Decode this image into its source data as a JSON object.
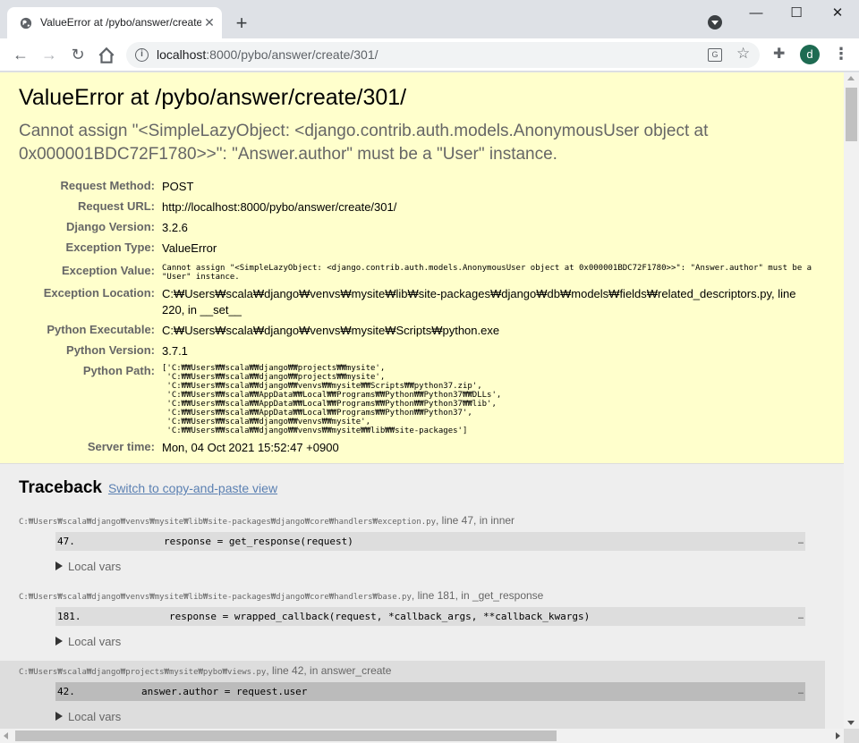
{
  "browser": {
    "tab_title": "ValueError at /pybo/answer/create/301/",
    "url_host": "localhost",
    "url_rest": ":8000/pybo/answer/create/301/",
    "avatar_letter": "d",
    "icons": [
      "globe-icon",
      "close-icon",
      "plus-icon",
      "tab-search-icon",
      "minimize-icon",
      "maximize-icon",
      "window-close-icon",
      "back-icon",
      "forward-icon",
      "reload-icon",
      "home-icon",
      "info-icon",
      "translate-icon",
      "star-icon",
      "extensions-icon",
      "menu-icon"
    ]
  },
  "error": {
    "title": "ValueError at /pybo/answer/create/301/",
    "message": "Cannot assign \"<SimpleLazyObject: <django.contrib.auth.models.AnonymousUser object at 0x000001BDC72F1780>>\": \"Answer.author\" must be a \"User\" instance."
  },
  "meta": [
    {
      "label": "Request Method:",
      "value": "POST"
    },
    {
      "label": "Request URL:",
      "value": "http://localhost:8000/pybo/answer/create/301/"
    },
    {
      "label": "Django Version:",
      "value": "3.2.6"
    },
    {
      "label": "Exception Type:",
      "value": "ValueError"
    },
    {
      "label": "Exception Value:",
      "value": "Cannot assign \"<SimpleLazyObject: <django.contrib.auth.models.AnonymousUser object at 0x000001BDC72F1780>>\": \"Answer.author\" must be a\n\"User\" instance."
    },
    {
      "label": "Exception Location:",
      "value": "C:₩Users₩scala₩django₩venvs₩mysite₩lib₩site-packages₩django₩db₩models₩fields₩related_descriptors.py, line 220, in __set__"
    },
    {
      "label": "Python Executable:",
      "value": "C:₩Users₩scala₩django₩venvs₩mysite₩Scripts₩python.exe"
    },
    {
      "label": "Python Version:",
      "value": "3.7.1"
    },
    {
      "label": "Python Path:",
      "value": "['C:₩₩Users₩₩scala₩₩django₩₩projects₩₩mysite',\n 'C:₩₩Users₩₩scala₩₩django₩₩projects₩₩mysite',\n 'C:₩₩Users₩₩scala₩₩django₩₩venvs₩₩mysite₩₩Scripts₩₩python37.zip',\n 'C:₩₩Users₩₩scala₩₩AppData₩₩Local₩₩Programs₩₩Python₩₩Python37₩₩DLLs',\n 'C:₩₩Users₩₩scala₩₩AppData₩₩Local₩₩Programs₩₩Python₩₩Python37₩₩lib',\n 'C:₩₩Users₩₩scala₩₩AppData₩₩Local₩₩Programs₩₩Python₩₩Python37',\n 'C:₩₩Users₩₩scala₩₩django₩₩venvs₩₩mysite',\n 'C:₩₩Users₩₩scala₩₩django₩₩venvs₩₩mysite₩₩lib₩₩site-packages']"
    },
    {
      "label": "Server time:",
      "value": "Mon, 04 Oct 2021 15:52:47 +0900"
    }
  ],
  "traceback": {
    "heading": "Traceback",
    "switch_link": "Switch to copy-and-paste view",
    "local_vars_label": "Local vars",
    "frames": [
      {
        "path": "C:₩Users₩scala₩django₩venvs₩mysite₩lib₩site-packages₩django₩core₩handlers₩exception.py",
        "suffix": ", line 47, in inner",
        "line": "47.",
        "code": "response = get_response(request)",
        "more": "…"
      },
      {
        "path": "C:₩Users₩scala₩django₩venvs₩mysite₩lib₩site-packages₩django₩core₩handlers₩base.py",
        "suffix": ", line 181, in _get_response",
        "line": "181.",
        "code": "response = wrapped_callback(request, *callback_args, **callback_kwargs)",
        "more": "…"
      },
      {
        "path": "C:₩Users₩scala₩django₩projects₩mysite₩pybo₩views.py",
        "suffix": ", line 42, in answer_create",
        "line": "42.",
        "code": "answer.author = request.user",
        "more": "…"
      }
    ]
  }
}
